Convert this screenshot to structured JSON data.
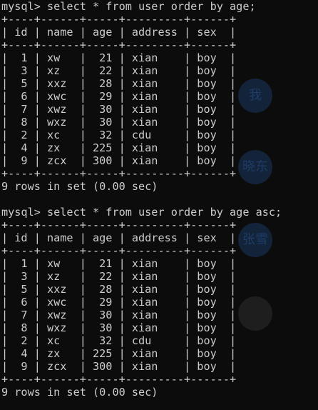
{
  "session": [
    {
      "command": "mysql> select * from user order by age;",
      "table": {
        "border": "+----+------+-----+---------+------+",
        "header": "| id | name | age | address | sex  |",
        "rows": [
          "|  1 | xw   |  21 | xian    | boy  |",
          "|  3 | xz   |  22 | xian    | boy  |",
          "|  5 | xxz  |  28 | xian    | boy  |",
          "|  6 | xwc  |  29 | xian    | boy  |",
          "|  7 | xwz  |  30 | xian    | boy  |",
          "|  8 | wxz  |  30 | xian    | boy  |",
          "|  2 | xc   |  32 | cdu     | boy  |",
          "|  4 | zx   | 225 | xian    | boy  |",
          "|  9 | zcx  | 300 | xian    | boy  |"
        ]
      },
      "summary": "9 rows in set (0.00 sec)"
    },
    {
      "command": "mysql> select * from user order by age asc;",
      "table": {
        "border": "+----+------+-----+---------+------+",
        "header": "| id | name | age | address | sex  |",
        "rows": [
          "|  1 | xw   |  21 | xian    | boy  |",
          "|  3 | xz   |  22 | xian    | boy  |",
          "|  5 | xxz  |  28 | xian    | boy  |",
          "|  6 | xwc  |  29 | xian    | boy  |",
          "|  7 | xwz  |  30 | xian    | boy  |",
          "|  8 | wxz  |  30 | xian    | boy  |",
          "|  2 | xc   |  32 | cdu     | boy  |",
          "|  4 | zx   | 225 | xian    | boy  |",
          "|  9 | zcx  | 300 | xian    | boy  |"
        ]
      },
      "summary": "9 rows in set (0.00 sec)"
    }
  ],
  "background_overlay": {
    "labels": [
      "我",
      "晓东",
      "张雪"
    ]
  },
  "colors": {
    "background": "#0c0c0c",
    "text": "#cccccc"
  }
}
